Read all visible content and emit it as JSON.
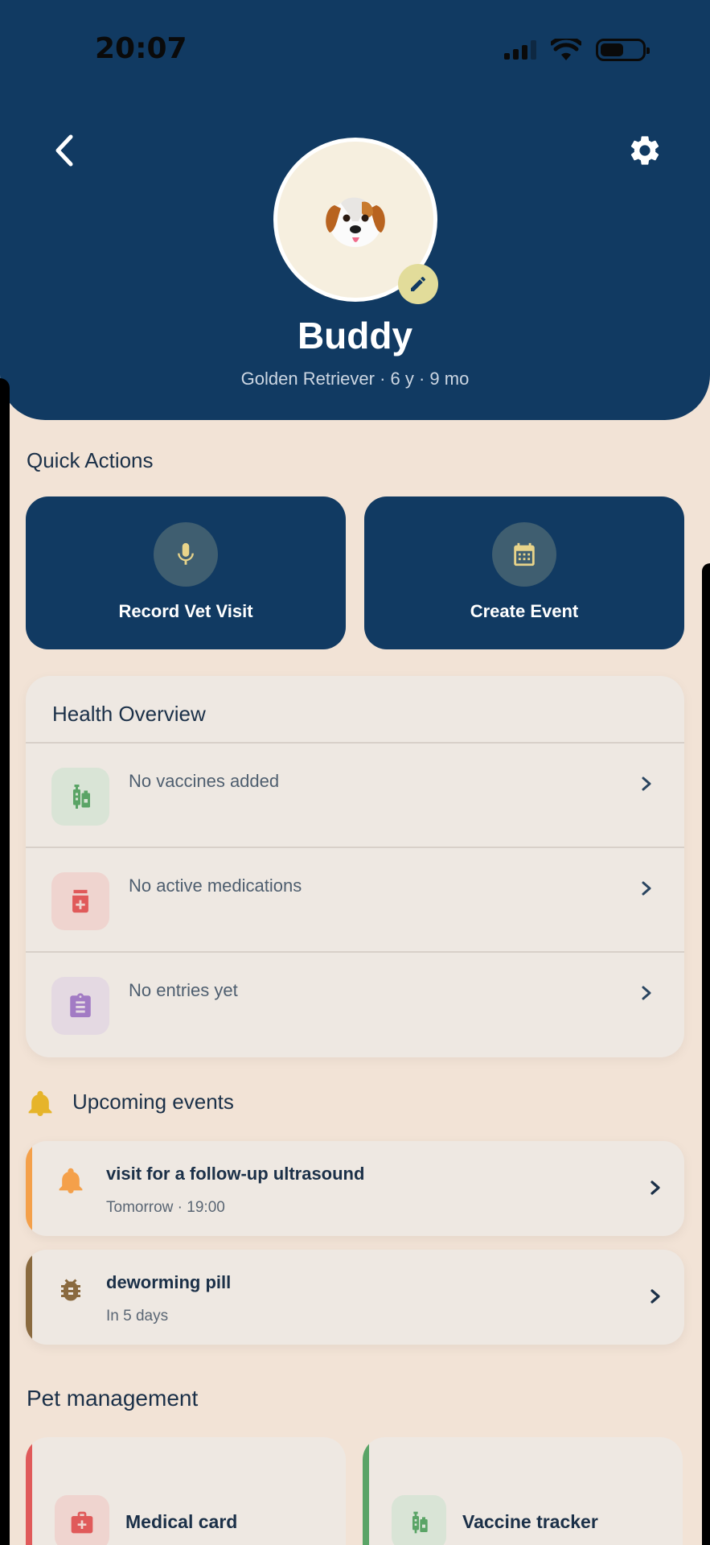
{
  "status_bar": {
    "time": "20:07",
    "battery_level": 0.55
  },
  "header": {
    "back_icon": "chevron-left-icon",
    "settings_icon": "gear-icon",
    "avatar_emoji": "🐶",
    "edit_icon": "pencil-icon",
    "pet_name": "Buddy",
    "pet_details": "Golden Retriever · 6 y · 9 mo"
  },
  "quick_actions": {
    "title": "Quick Actions",
    "items": [
      {
        "label": "Record Vet Visit",
        "icon": "microphone-icon"
      },
      {
        "label": "Create Event",
        "icon": "calendar-icon"
      }
    ]
  },
  "health_overview": {
    "title": "Health Overview",
    "rows": [
      {
        "text": "No vaccines added",
        "icon": "vaccine-icon",
        "color": "#5aa466"
      },
      {
        "text": "No active medications",
        "icon": "medication-icon",
        "color": "#e05a5a"
      },
      {
        "text": "No entries yet",
        "icon": "clipboard-icon",
        "color": "#a27bc4"
      }
    ]
  },
  "upcoming": {
    "title": "Upcoming events",
    "header_icon": "🔔",
    "events": [
      {
        "title": "visit for a follow-up ultrasound",
        "when": "Tomorrow · 19:00",
        "icon": "bell-icon",
        "color": "#f4a04a"
      },
      {
        "title": "deworming pill",
        "when": "In 5 days",
        "icon": "bug-icon",
        "color": "#8a6a3f"
      }
    ]
  },
  "pet_management": {
    "title": "Pet management",
    "items": [
      {
        "label": "Medical card",
        "icon": "first-aid-icon",
        "color": "#e05a5a"
      },
      {
        "label": "Vaccine tracker",
        "icon": "vaccine-icon",
        "color": "#5aa466"
      }
    ]
  },
  "colors": {
    "navy": "#113a62",
    "background": "#f2e3d6",
    "card": "#eee8e2"
  }
}
